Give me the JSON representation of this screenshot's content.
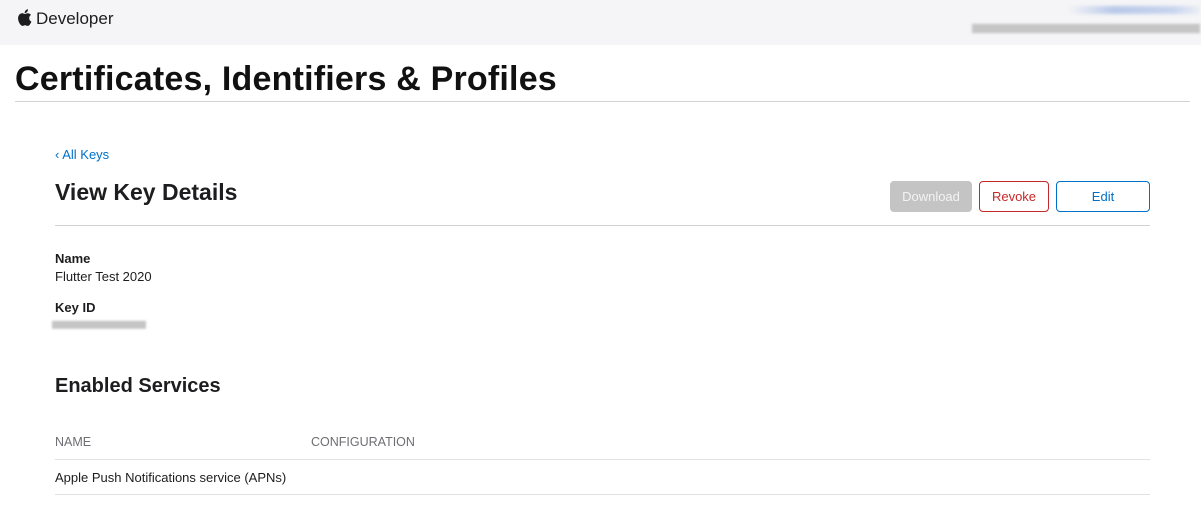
{
  "topbar": {
    "brand": "Developer",
    "account_redacted": true
  },
  "page": {
    "title": "Certificates, Identifiers & Profiles"
  },
  "breadcrumb": {
    "back_label": "‹ All Keys"
  },
  "key_details": {
    "heading": "View Key Details",
    "buttons": {
      "download": "Download",
      "revoke": "Revoke",
      "edit": "Edit"
    },
    "download_disabled": true,
    "name_label": "Name",
    "name_value": "Flutter Test 2020",
    "key_id_label": "Key ID",
    "key_id_redacted": true
  },
  "services": {
    "heading": "Enabled Services",
    "columns": [
      "NAME",
      "CONFIGURATION"
    ],
    "rows": [
      {
        "name": "Apple Push Notifications service (APNs)",
        "configuration": ""
      }
    ]
  },
  "colors": {
    "link": "#0070c9",
    "danger": "#c62828",
    "disabled": "#c4c4c4",
    "topbar_bg": "#f5f5f7"
  },
  "icons": {
    "logo": "apple-logo-icon"
  }
}
